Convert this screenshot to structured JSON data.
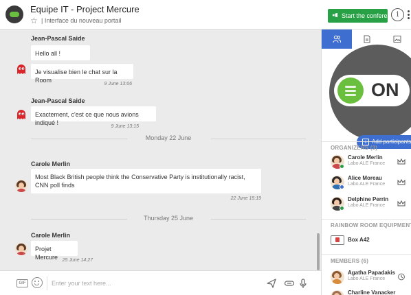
{
  "header": {
    "room_title": "Equipe IT - Project Mercure",
    "room_subtitle": "| Interface du nouveau portail",
    "conference_label": "Start the conference",
    "info_label": "i"
  },
  "chat": {
    "messages": [
      {
        "sender": "Jean-Pascal Saide",
        "lines": [
          "Hello all !",
          "Je visualise bien le chat sur la Room"
        ],
        "time": "9 June 13:06"
      },
      {
        "sender": "Jean-Pascal Saide",
        "lines": [
          "Exactement, c'est ce que nous avions indiqué !"
        ],
        "time": "9 June 13:15"
      },
      {
        "sender": "Carole Merlin",
        "lines": [
          "Most Black British people think the Conservative Party is institutionally racist, CNN poll finds"
        ],
        "time": "22 June 15:19"
      },
      {
        "sender": "Carole Merlin",
        "lines": [
          "Projet Mercure"
        ],
        "time": "25 June 14:27"
      }
    ],
    "dividers": [
      "Monday 22 June",
      "Thursday 25 June"
    ]
  },
  "composer": {
    "gif_label": "GIF",
    "placeholder": "Enter your text here..."
  },
  "sidebar": {
    "on_label": "ON",
    "add_participants_label": "Add participants",
    "organizers_title": "ORGANIZERS (3)",
    "organizers": [
      {
        "name": "Carole Merlin",
        "org": "Labo ALE France",
        "status_color": "#27a046",
        "icon": "crown-icon"
      },
      {
        "name": "Alice Moreau",
        "org": "Labo ALE France",
        "status_color": "#3e6fd0",
        "icon": "crown-icon"
      },
      {
        "name": "Delphine Perrin",
        "org": "Labo ALE France",
        "status_color": "#27a046",
        "icon": "crown-icon"
      }
    ],
    "equipment_title": "RAINBOW ROOM EQUIPMENT",
    "equipment": [
      {
        "name": "Box A42",
        "icon": "room-device-icon"
      }
    ],
    "members_title": "MEMBERS (6)",
    "members": [
      {
        "name": "Agatha Papadakis",
        "org": "Labo ALE France",
        "icon": "clock-icon"
      },
      {
        "name": "Charline Vanacker",
        "org": "",
        "icon": ""
      }
    ]
  },
  "colors": {
    "accent_blue": "#3e6fd0",
    "conference_green": "#27a046",
    "toggle_green": "#6bbf3f",
    "ghost_red": "#d9262b"
  }
}
